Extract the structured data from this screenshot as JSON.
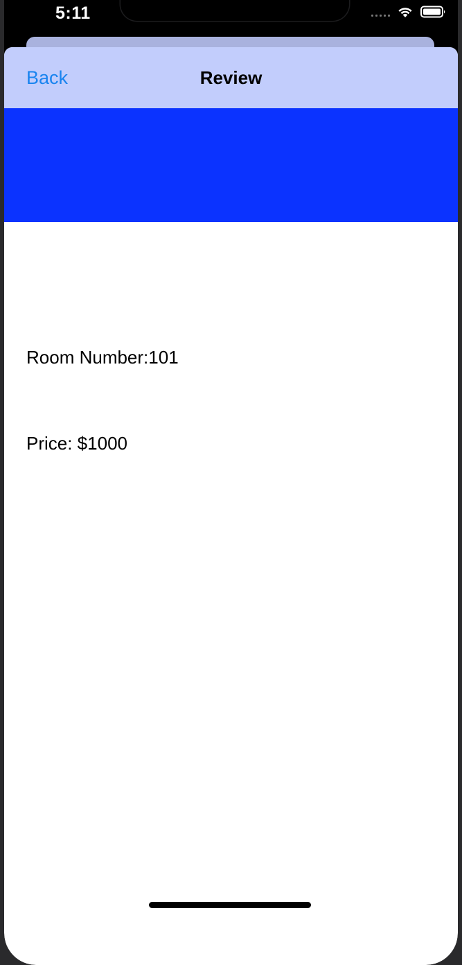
{
  "status_bar": {
    "time": "5:11",
    "signal_icon": "signal-dots-icon",
    "wifi_icon": "wifi-icon",
    "battery_icon": "battery-icon"
  },
  "nav": {
    "back_label": "Back",
    "title": "Review"
  },
  "colors": {
    "nav_background": "#c2cdfc",
    "banner": "#0b33ff",
    "back_link": "#1a84ef"
  },
  "content": {
    "room_number": "Room Number:101",
    "price": "Price: $1000"
  }
}
